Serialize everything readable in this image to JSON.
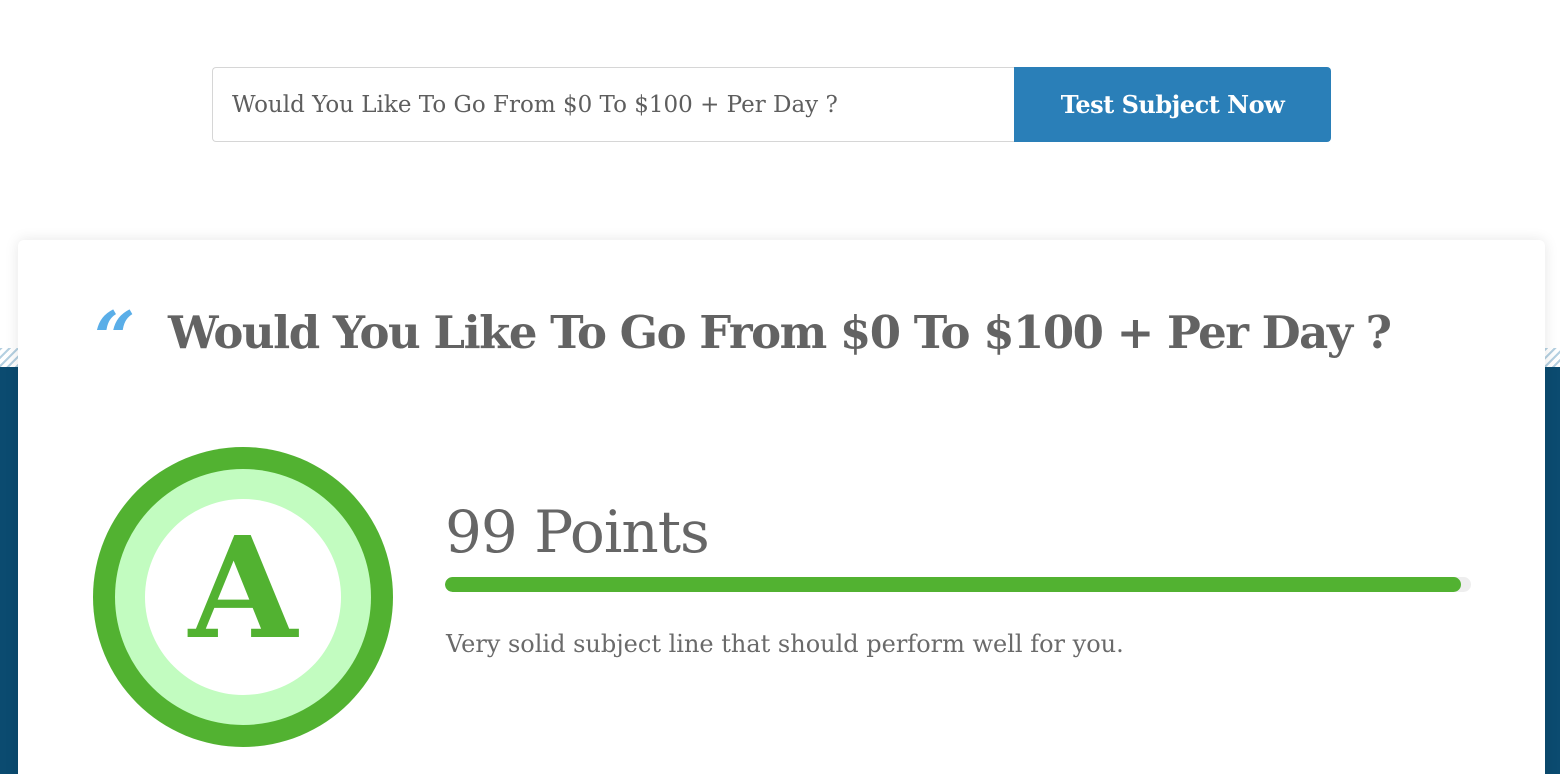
{
  "search": {
    "value": "Would You Like To Go From $0 To $100 + Per Day ?",
    "button_label": "Test Subject Now"
  },
  "result": {
    "quote_icon": "quote-mark-icon",
    "subject": "Would You Like To Go From $0 To $100 + Per Day ?",
    "grade": "A",
    "points_label": "99 Points",
    "score_fraction": 0.99,
    "description": "Very solid subject line that should perform well for you."
  },
  "colors": {
    "button_blue": "#2a7fb8",
    "band_navy": "#0b4b70",
    "quote_blue": "#5aaee8",
    "grade_green": "#52b231",
    "grade_light_green": "#c2fcc0",
    "bar_green": "#52b231"
  }
}
